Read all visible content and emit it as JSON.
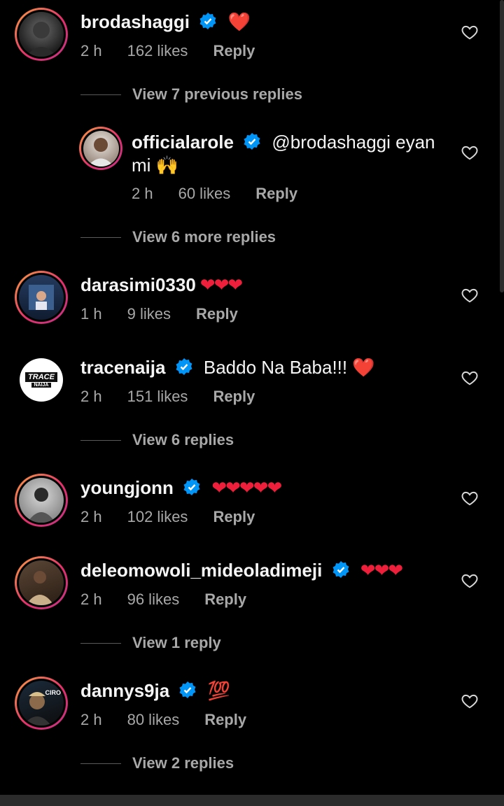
{
  "comments": [
    {
      "username": "brodashaggi",
      "text": "❤️",
      "time": "2 h",
      "likes": "162 likes",
      "reply": "Reply"
    },
    {
      "username": "officialarole",
      "text_line1": "@brodashaggi eyan",
      "text_line2": "mi 🙌",
      "time": "2 h",
      "likes": "60 likes",
      "reply": "Reply"
    },
    {
      "username": "darasimi0330",
      "text": "❤❤❤",
      "time": "1 h",
      "likes": "9 likes",
      "reply": "Reply"
    },
    {
      "username": "tracenaija",
      "text": "Baddo Na Baba!!! ❤️",
      "time": "2 h",
      "likes": "151 likes",
      "reply": "Reply"
    },
    {
      "username": "youngjonn",
      "text": "❤❤❤❤❤",
      "time": "2 h",
      "likes": "102 likes",
      "reply": "Reply"
    },
    {
      "username": "deleomowoli_mideoladimeji",
      "text": "❤❤❤",
      "time": "2 h",
      "likes": "96 likes",
      "reply": "Reply"
    },
    {
      "username": "dannys9ja",
      "text": "💯",
      "time": "2 h",
      "likes": "80 likes",
      "reply": "Reply"
    }
  ],
  "view_links": {
    "brodashaggi": "View 7 previous replies",
    "arole": "View 6 more replies",
    "tracenaija": "View 6 replies",
    "deleomowoli": "View 1 reply",
    "dannys9ja": "View 2 replies"
  },
  "avatar_texts": {
    "tracenaija_top": "TRACE",
    "tracenaija_bottom": "NAIJA",
    "dannys9ja": "CIRO"
  },
  "colors": {
    "background": "#000000",
    "text": "#f5f5f5",
    "meta": "#a8a8a8",
    "verified": "#0095f6",
    "heart": "#ed1f3a"
  },
  "icons": {
    "verified": "verified-badge-icon",
    "like": "heart-outline-icon"
  }
}
